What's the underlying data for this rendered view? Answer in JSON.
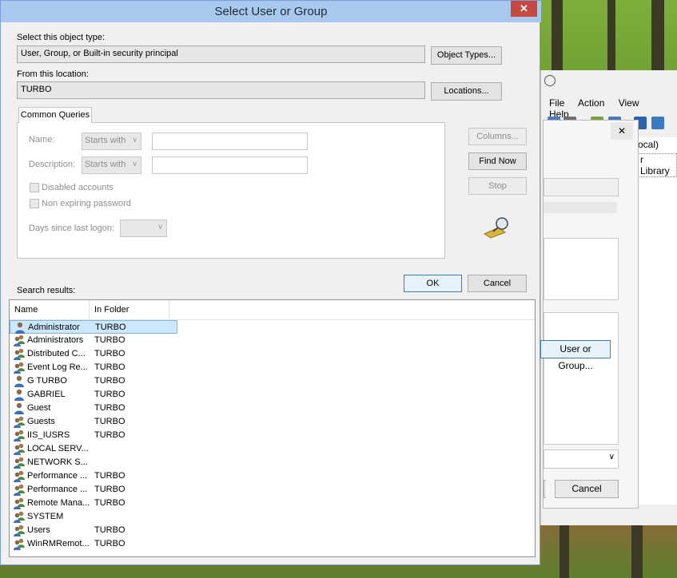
{
  "dialog": {
    "title": "Select User or Group",
    "close_glyph": "✕",
    "object_type_label": "Select this object type:",
    "object_type_value": "User, Group, or Built-in security principal",
    "object_types_button": "Object Types...",
    "location_label": "From this location:",
    "location_value": "TURBO",
    "locations_button": "Locations...",
    "common_queries_tab": "Common Queries",
    "name_label": "Name:",
    "name_mode": "Starts with",
    "description_label": "Description:",
    "description_mode": "Starts with",
    "disabled_accounts_label": "Disabled accounts",
    "non_expiring_password_label": "Non expiring password",
    "days_since_logon_label": "Days since last logon:",
    "columns_button": "Columns...",
    "find_now_button": "Find Now",
    "stop_button": "Stop",
    "ok_button": "OK",
    "cancel_button": "Cancel",
    "search_results_label": "Search results:",
    "results": {
      "columns": [
        "Name",
        "In Folder"
      ],
      "rows": [
        {
          "name": "Administrator",
          "folder": "TURBO",
          "icon": "user-icon",
          "selected": true
        },
        {
          "name": "Administrators",
          "folder": "TURBO",
          "icon": "group-icon"
        },
        {
          "name": "Distributed C...",
          "folder": "TURBO",
          "icon": "group-icon"
        },
        {
          "name": "Event Log Re...",
          "folder": "TURBO",
          "icon": "group-icon"
        },
        {
          "name": "G TURBO",
          "folder": "TURBO",
          "icon": "user-icon"
        },
        {
          "name": "GABRIEL",
          "folder": "TURBO",
          "icon": "user-icon"
        },
        {
          "name": "Guest",
          "folder": "TURBO",
          "icon": "user-icon"
        },
        {
          "name": "Guests",
          "folder": "TURBO",
          "icon": "group-icon"
        },
        {
          "name": "IIS_IUSRS",
          "folder": "TURBO",
          "icon": "group-icon"
        },
        {
          "name": "LOCAL SERV...",
          "folder": "",
          "icon": "group-icon"
        },
        {
          "name": "NETWORK S...",
          "folder": "",
          "icon": "group-icon"
        },
        {
          "name": "Performance ...",
          "folder": "TURBO",
          "icon": "group-icon"
        },
        {
          "name": "Performance ...",
          "folder": "TURBO",
          "icon": "group-icon"
        },
        {
          "name": "Remote Mana...",
          "folder": "TURBO",
          "icon": "group-icon"
        },
        {
          "name": "SYSTEM",
          "folder": "",
          "icon": "group-icon"
        },
        {
          "name": "Users",
          "folder": "TURBO",
          "icon": "group-icon"
        },
        {
          "name": "WinRMRemot...",
          "folder": "TURBO",
          "icon": "group-icon"
        }
      ]
    }
  },
  "background_window": {
    "menu": [
      "File",
      "Action",
      "View",
      "Help"
    ],
    "tree_items": [
      "ocal)",
      "r Library"
    ],
    "user_or_group_button": "User or Group...",
    "cancel_button": "Cancel"
  },
  "colors": {
    "titlebar": "#a8c8ee",
    "close": "#c7483e",
    "selection": "#cce8ff"
  }
}
